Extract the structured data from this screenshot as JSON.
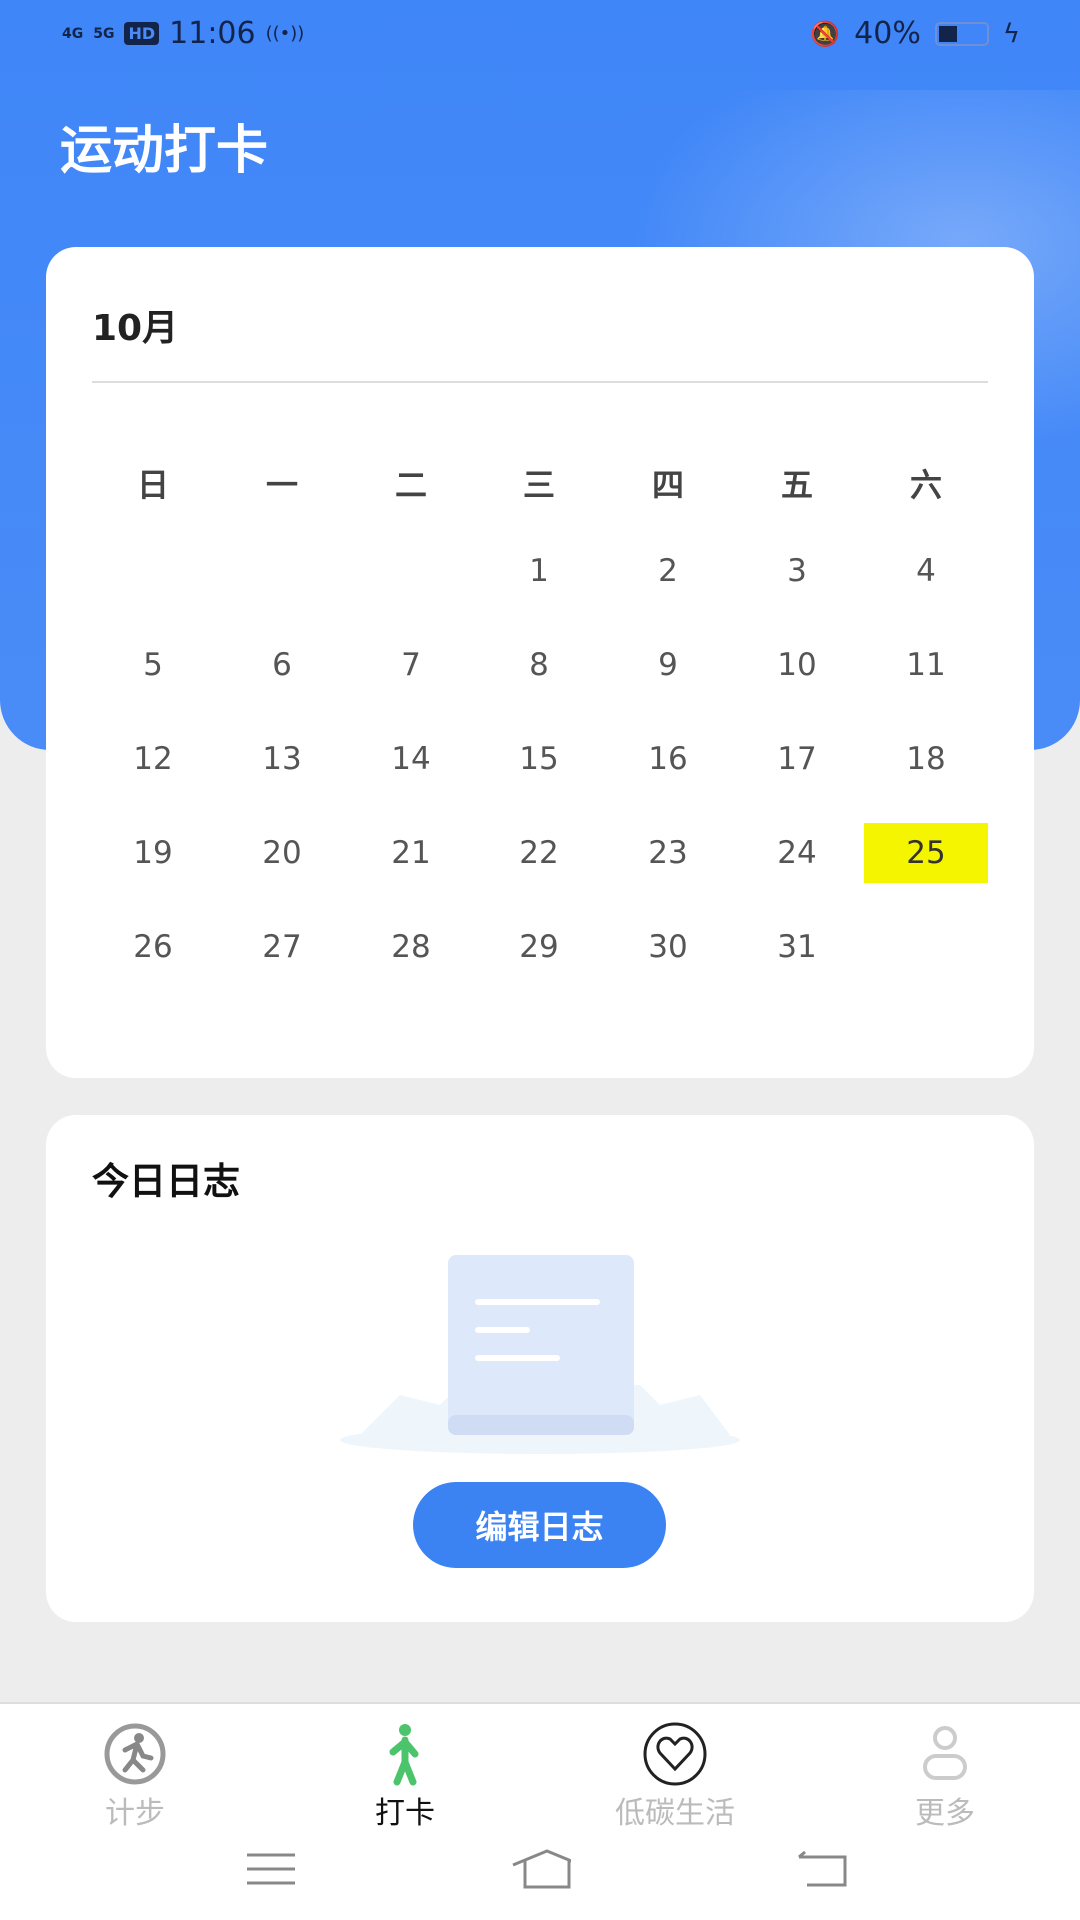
{
  "status_bar": {
    "network1": "4G",
    "network2": "5G",
    "hd": "HD",
    "time": "11:06",
    "battery": "40%",
    "battery_level": 0.4
  },
  "header": {
    "title": "运动打卡"
  },
  "calendar": {
    "month": "10月",
    "weekdays": [
      "日",
      "一",
      "二",
      "三",
      "四",
      "五",
      "六"
    ],
    "first_weekday_index": 3,
    "days": [
      "1",
      "2",
      "3",
      "4",
      "5",
      "6",
      "7",
      "8",
      "9",
      "10",
      "11",
      "12",
      "13",
      "14",
      "15",
      "16",
      "17",
      "18",
      "19",
      "20",
      "21",
      "22",
      "23",
      "24",
      "25",
      "26",
      "27",
      "28",
      "29",
      "30",
      "31"
    ],
    "highlighted_day": "25",
    "highlight_color": "#f5f500"
  },
  "log": {
    "title": "今日日志",
    "edit_button": "编辑日志",
    "accent": "#3b82f2"
  },
  "tabbar": {
    "items": [
      {
        "label": "计步",
        "icon": "running-icon",
        "active": false
      },
      {
        "label": "打卡",
        "icon": "walking-person-icon",
        "active": true
      },
      {
        "label": "低碳生活",
        "icon": "heart-circle-icon",
        "active": false
      },
      {
        "label": "更多",
        "icon": "person-icon",
        "active": false
      }
    ],
    "active_color": "#4cc46c"
  },
  "system_nav": [
    "menu-icon",
    "home-icon",
    "back-icon"
  ]
}
